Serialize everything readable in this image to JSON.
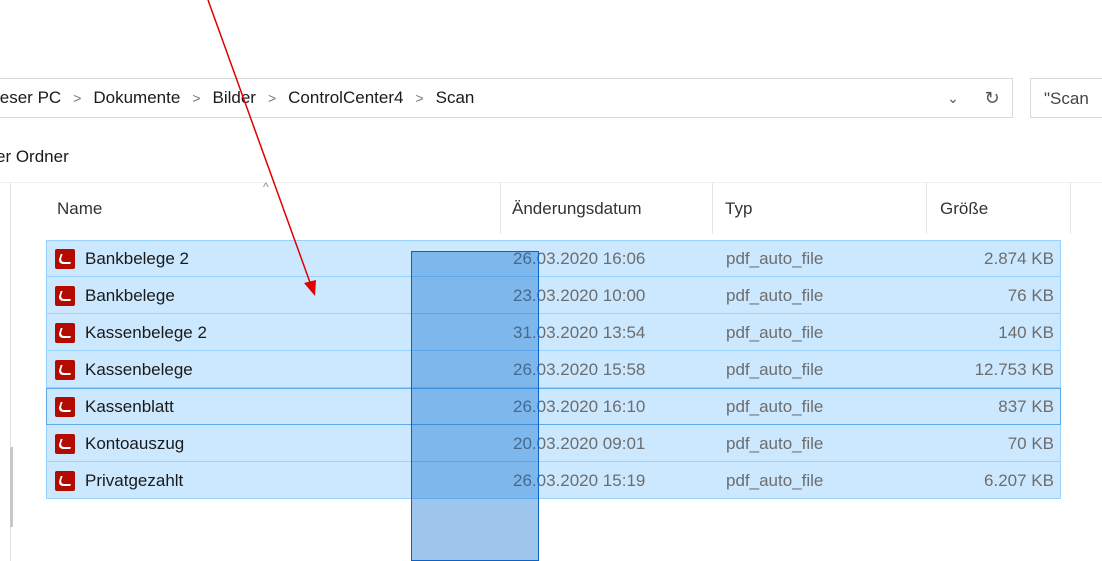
{
  "breadcrumb": [
    "ieser PC",
    "Dokumente",
    "Bilder",
    "ControlCenter4",
    "Scan"
  ],
  "address_actions": {
    "dropdown": "chevron-down-icon",
    "refresh": "refresh-icon"
  },
  "search": {
    "value": "\"Scan"
  },
  "section_label": "er Ordner",
  "columns": {
    "name": "Name",
    "date": "Änderungsdatum",
    "type": "Typ",
    "size": "Größe"
  },
  "files": [
    {
      "name": "Bankbelege 2",
      "date": "26.03.2020 16:06",
      "type": "pdf_auto_file",
      "size": "2.874 KB"
    },
    {
      "name": "Bankbelege",
      "date": "23.03.2020 10:00",
      "type": "pdf_auto_file",
      "size": "76 KB"
    },
    {
      "name": "Kassenbelege 2",
      "date": "31.03.2020 13:54",
      "type": "pdf_auto_file",
      "size": "140 KB"
    },
    {
      "name": "Kassenbelege",
      "date": "26.03.2020 15:58",
      "type": "pdf_auto_file",
      "size": "12.753 KB"
    },
    {
      "name": "Kassenblatt",
      "date": "26.03.2020 16:10",
      "type": "pdf_auto_file",
      "size": "837 KB"
    },
    {
      "name": "Kontoauszug",
      "date": "20.03.2020 09:01",
      "type": "pdf_auto_file",
      "size": "70 KB"
    },
    {
      "name": "Privatgezahlt",
      "date": "26.03.2020 15:19",
      "type": "pdf_auto_file",
      "size": "6.207 KB"
    }
  ],
  "colors": {
    "selection_fill": "#cce8ff",
    "selection_border": "#99d1ff",
    "lasso": "#0a64c8",
    "arrow": "#e00000",
    "pdf_icon": "#b30b00"
  }
}
